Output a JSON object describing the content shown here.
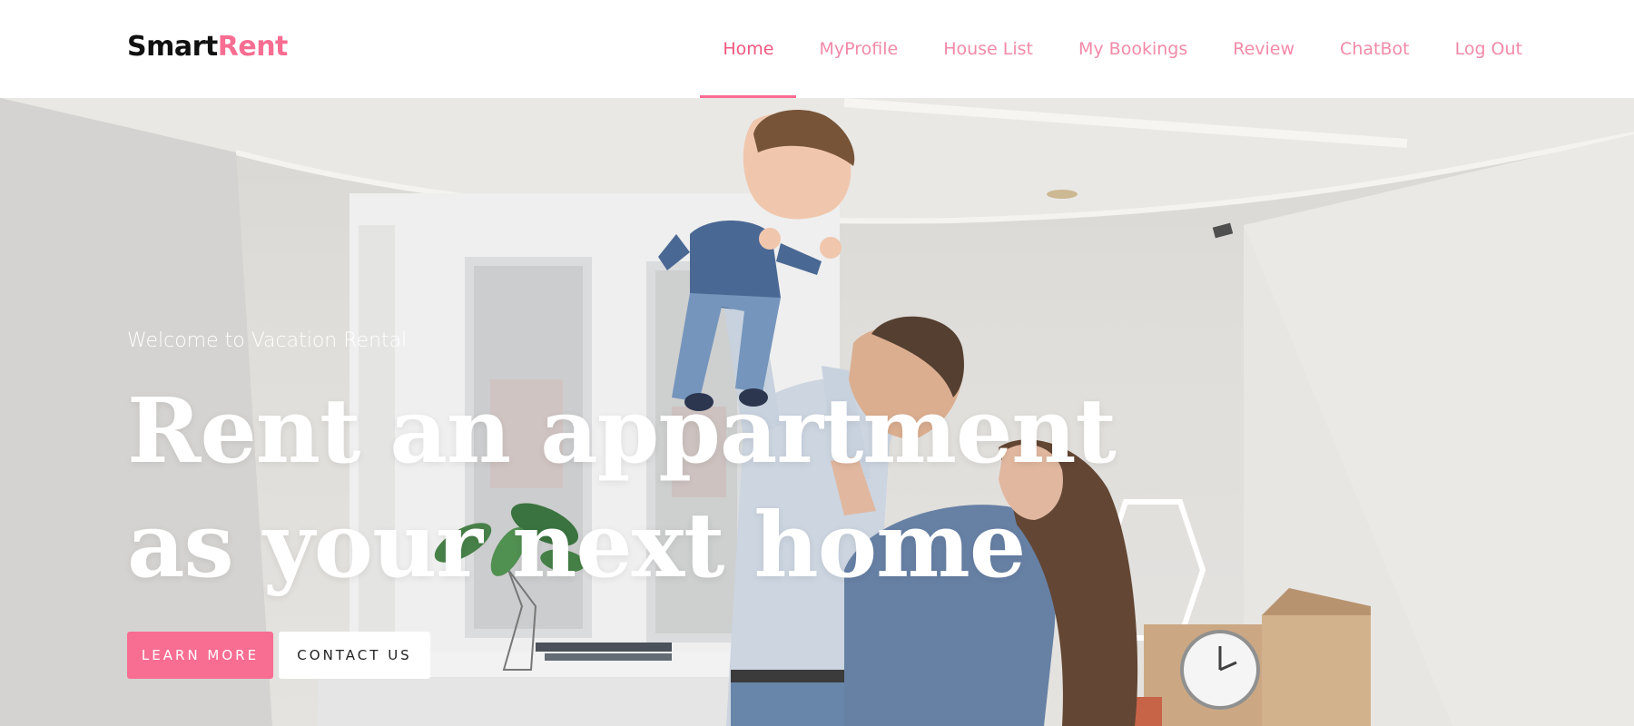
{
  "brand": {
    "part1": "Smart",
    "part2": "Rent",
    "accent_color": "#f86d92"
  },
  "nav": {
    "items": [
      {
        "label": "Home",
        "active": true
      },
      {
        "label": "MyProfile"
      },
      {
        "label": "House List"
      },
      {
        "label": "My Bookings"
      },
      {
        "label": "Review"
      },
      {
        "label": "ChatBot"
      },
      {
        "label": "Log Out"
      }
    ]
  },
  "hero": {
    "welcome": "Welcome to Vacation Rental",
    "headline_line1": "Rent an appartment",
    "headline_line2": "as your next home",
    "learn_more": "LEARN MORE",
    "contact_us": "CONTACT US",
    "image": "family-moving-in-photo"
  }
}
